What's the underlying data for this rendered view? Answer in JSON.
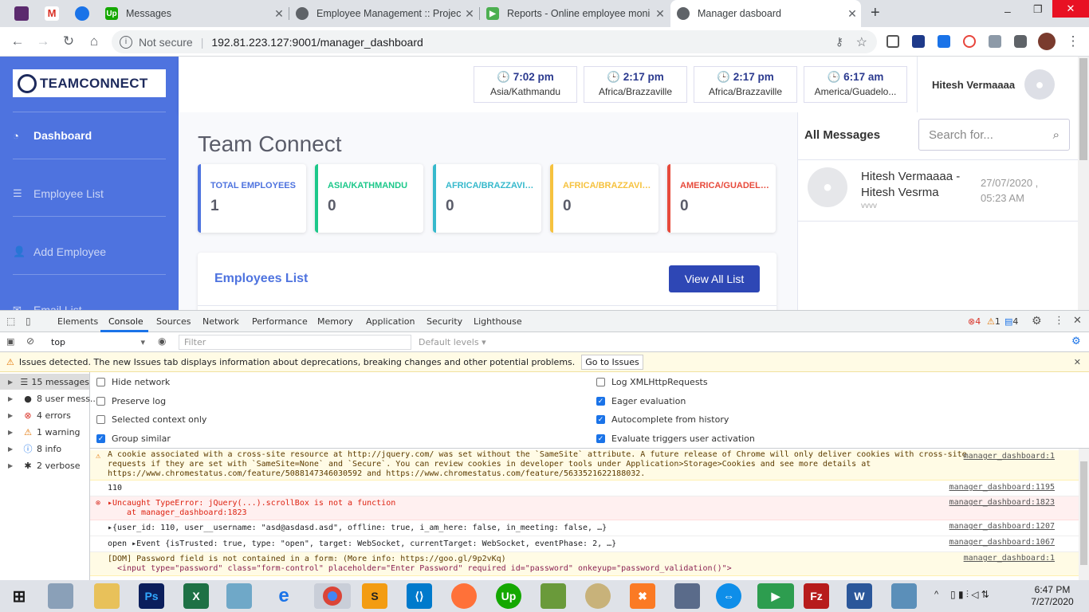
{
  "browser": {
    "tabs": [
      {
        "title": "Messages"
      },
      {
        "title": "Employee Management :: Project"
      },
      {
        "title": "Reports - Online employee moni"
      },
      {
        "title": "Manager dasboard"
      }
    ],
    "new_tab": "+",
    "security_label": "Not secure",
    "url": "192.81.223.127:9001/manager_dashboard",
    "window_controls": [
      "–",
      "❐",
      "✕"
    ]
  },
  "sidebar": {
    "brand": "TEAMCONNECT",
    "items": [
      {
        "label": "Dashboard",
        "icon": "tachometer-icon"
      },
      {
        "label": "Employee List",
        "icon": "list-icon"
      },
      {
        "label": "Add Employee",
        "icon": "user-plus-icon"
      },
      {
        "label": "Email List",
        "icon": "envelope-icon"
      }
    ]
  },
  "topbar": {
    "clocks": [
      {
        "time": "7:02 pm",
        "zone": "Asia/Kathmandu"
      },
      {
        "time": "2:17 pm",
        "zone": "Africa/Brazzaville"
      },
      {
        "time": "2:17 pm",
        "zone": "Africa/Brazzaville"
      },
      {
        "time": "6:17 am",
        "zone": "America/Guadelo..."
      }
    ],
    "user_name": "Hitesh Vermaaaa"
  },
  "main": {
    "title": "Team Connect",
    "cards": [
      {
        "label": "TOTAL EMPLOYEES",
        "value": "1",
        "color": "#4e73df"
      },
      {
        "label": "ASIA/KATHMANDU",
        "value": "0",
        "color": "#1cc88a"
      },
      {
        "label": "AFRICA/BRAZZAVILLE",
        "value": "0",
        "color": "#36b9cc"
      },
      {
        "label": "AFRICA/BRAZZAVILLE",
        "value": "0",
        "color": "#f6c23e"
      },
      {
        "label": "AMERICA/GUADELOUPE",
        "value": "0",
        "color": "#e74a3b"
      }
    ],
    "employees_heading": "Employees List",
    "view_all_label": "View All List"
  },
  "messages": {
    "heading": "All Messages",
    "search_placeholder": "Search for...",
    "items": [
      {
        "name": "Hitesh Vermaaaa - Hitesh Vesrma",
        "preview": "vvvv",
        "date": "27/07/2020 ,",
        "time": "05:23 AM"
      }
    ]
  },
  "devtools": {
    "tabs": [
      "Elements",
      "Console",
      "Sources",
      "Network",
      "Performance",
      "Memory",
      "Application",
      "Security",
      "Lighthouse"
    ],
    "error_count": "4",
    "warning_count": "1",
    "info_count": "4",
    "context": "top",
    "filter_placeholder": "Filter",
    "levels": "Default levels ▾",
    "issues_text": "Issues detected. The new Issues tab displays information about deprecations, breaking changes and other potential problems.",
    "issues_button": "Go to Issues",
    "sidebar": [
      {
        "label": "15 messages"
      },
      {
        "label": "8 user mess..."
      },
      {
        "label": "4 errors"
      },
      {
        "label": "1 warning"
      },
      {
        "label": "8 info"
      },
      {
        "label": "2 verbose"
      }
    ],
    "settings_left": [
      {
        "label": "Hide network",
        "checked": false
      },
      {
        "label": "Preserve log",
        "checked": false
      },
      {
        "label": "Selected context only",
        "checked": false
      },
      {
        "label": "Group similar",
        "checked": true
      }
    ],
    "settings_right": [
      {
        "label": "Log XMLHttpRequests",
        "checked": false
      },
      {
        "label": "Eager evaluation",
        "checked": true
      },
      {
        "label": "Autocomplete from history",
        "checked": true
      },
      {
        "label": "Evaluate triggers user activation",
        "checked": true
      }
    ],
    "console_lines": [
      {
        "text": "A cookie associated with a cross-site resource at http://jquery.com/ was set without the `SameSite` attribute. A future release of Chrome will only deliver cookies with cross-site requests if they are set with `SameSite=None` and `Secure`. You can review cookies in developer tools under Application>Storage>Cookies and see more details at https://www.chromestatus.com/feature/5088147346030592 and https://www.chromestatus.com/feature/5633521622188032.",
        "source": "manager_dashboard:1"
      },
      {
        "text": "110",
        "source": "manager_dashboard:1195"
      },
      {
        "text": "▸Uncaught TypeError: jQuery(...).scrollBox is not a function",
        "text2": "at manager_dashboard:1823",
        "source": "manager_dashboard:1823"
      },
      {
        "text": "▸{user_id: 110, user__username: \"asd@asdasd.asd\", offline: true, i_am_here: false, in_meeting: false, …}",
        "source": "manager_dashboard:1207"
      },
      {
        "text": "open ▸Event {isTrusted: true, type: \"open\", target: WebSocket, currentTarget: WebSocket, eventPhase: 2, …}",
        "source": "manager_dashboard:1067"
      },
      {
        "text": "[DOM] Password field is not contained in a form: (More info: https://goo.gl/9p2vKq)",
        "text2": "<input type=\"password\" class=\"form-control\" placeholder=\"Enter Password\" required id=\"password\" onkeyup=\"password_validation()\">",
        "source": "manager_dashboard:1"
      }
    ]
  },
  "taskbar": {
    "time": "6:47 PM",
    "date": "7/27/2020"
  }
}
